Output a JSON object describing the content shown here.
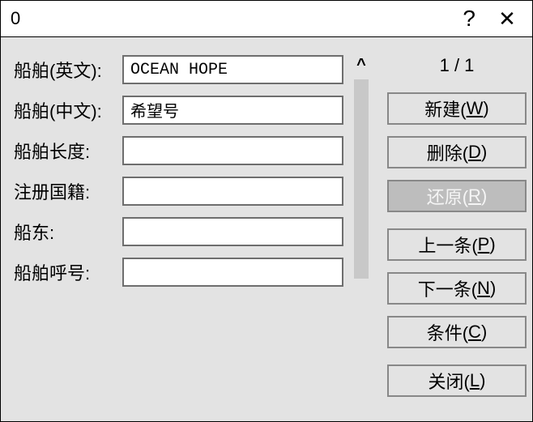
{
  "titlebar": {
    "title": "0",
    "help": "?",
    "close": "✕"
  },
  "form": {
    "rows": [
      {
        "label": "船舶(英文):",
        "value": "OCEAN HOPE"
      },
      {
        "label": "船舶(中文):",
        "value": "希望号"
      },
      {
        "label": "船舶长度:",
        "value": ""
      },
      {
        "label": "注册国籍:",
        "value": ""
      },
      {
        "label": "船东:",
        "value": ""
      },
      {
        "label": "船舶呼号:",
        "value": ""
      }
    ]
  },
  "counter": {
    "current": 1,
    "total": 1,
    "text": "1 / 1"
  },
  "buttons": {
    "new": {
      "text": "新建(",
      "accel": "W",
      "suffix": ")"
    },
    "delete": {
      "text": "删除(",
      "accel": "D",
      "suffix": ")"
    },
    "restore": {
      "text": "还原(",
      "accel": "R",
      "suffix": ")",
      "disabled": true
    },
    "prev": {
      "text": "上一条(",
      "accel": "P",
      "suffix": ")"
    },
    "next": {
      "text": "下一条(",
      "accel": "N",
      "suffix": ")"
    },
    "cond": {
      "text": "条件(",
      "accel": "C",
      "suffix": ")"
    },
    "close": {
      "text": "关闭(",
      "accel": "L",
      "suffix": ")"
    }
  }
}
